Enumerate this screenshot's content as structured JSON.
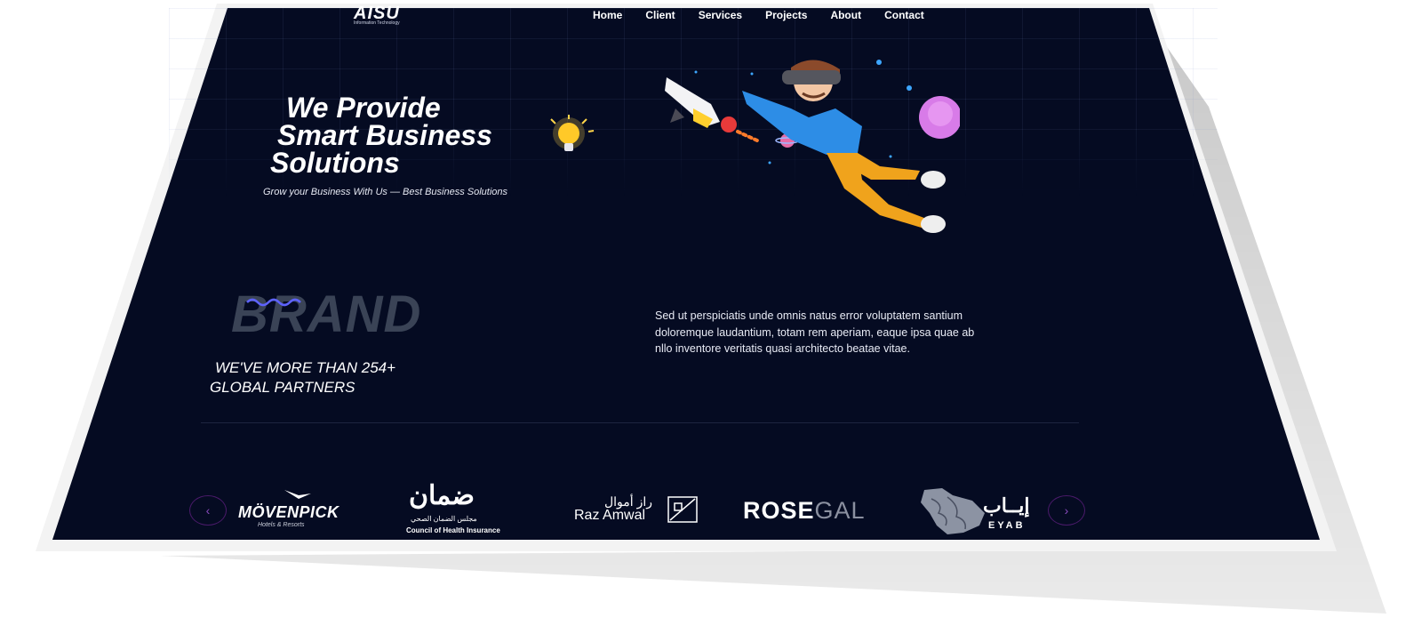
{
  "header": {
    "logo_text": "AISU",
    "logo_sub": "Information Technology",
    "nav": [
      "Home",
      "Client",
      "Services",
      "Projects",
      "About",
      "Contact"
    ]
  },
  "hero": {
    "title_lines": [
      "We Provide",
      "Smart Business",
      "Solutions"
    ],
    "tagline": "Grow your Business With Us — Best Business Solutions"
  },
  "brand": {
    "watermark": "BRAND",
    "partners_lines": [
      "WE'VE MORE THAN 254+",
      "GLOBAL PARTNERS"
    ],
    "paragraph": "Sed ut perspiciatis unde omnis natus error voluptatem santium doloremque laudantium, totam rem aperiam, eaque ipsa quae ab nllo inventore veritatis quasi architecto beatae vitae."
  },
  "clients": {
    "prev_icon": "chevron-left-icon",
    "next_icon": "chevron-right-icon",
    "movenpick": {
      "name": "MÖVENPICK",
      "sub": "Hotels & Resorts"
    },
    "damaan": {
      "arabic": "ضمان",
      "arabic_sub": "مجلس الضمان الصحي",
      "english": "Council of Health Insurance"
    },
    "raz": {
      "arabic": "راز أموال",
      "english": "Raz Amwal"
    },
    "rosegal": {
      "bold": "ROSE",
      "light": "GAL"
    },
    "eyab": {
      "arabic": "إيــاب",
      "english": "EYAB"
    }
  },
  "colors": {
    "background": "#050b22",
    "arrow_accent": "#8a4bbd",
    "brand_watermark": "#3a4356"
  }
}
